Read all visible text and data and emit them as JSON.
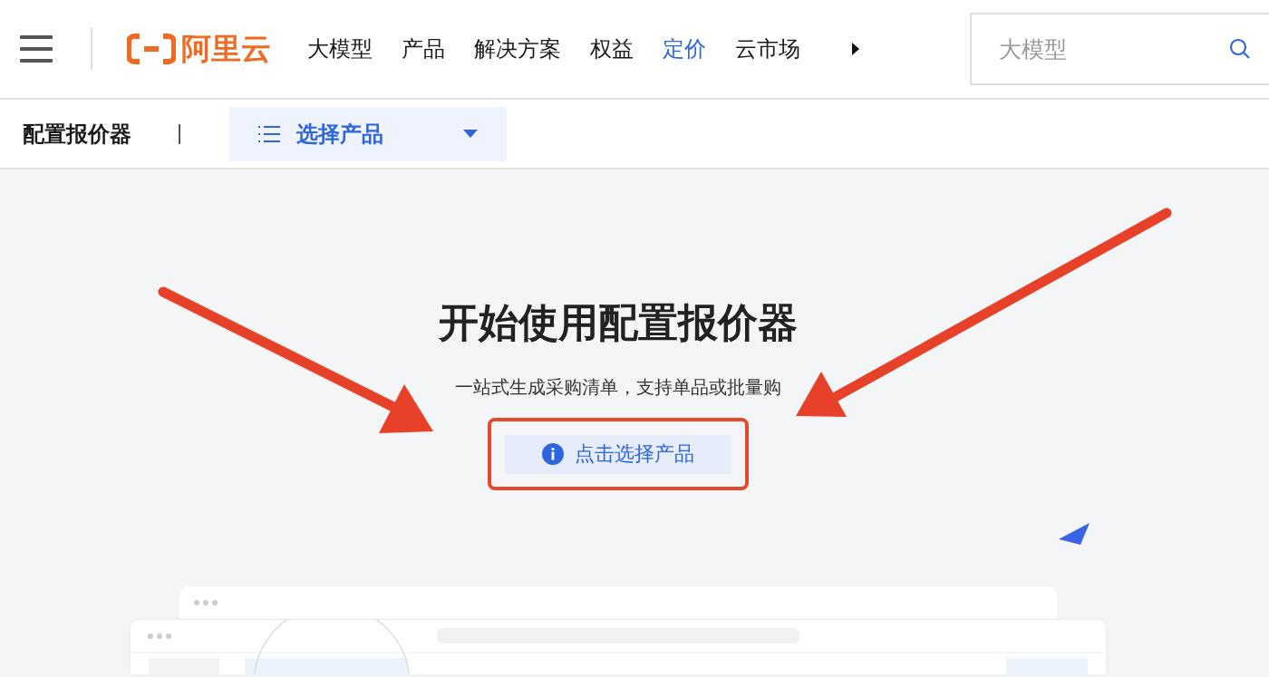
{
  "header": {
    "logo_text": "阿里云",
    "nav": [
      {
        "label": "大模型",
        "selected": false
      },
      {
        "label": "产品",
        "selected": false
      },
      {
        "label": "解决方案",
        "selected": false
      },
      {
        "label": "权益",
        "selected": false
      },
      {
        "label": "定价",
        "selected": true
      },
      {
        "label": "云市场",
        "selected": false
      }
    ],
    "search": {
      "placeholder": "大模型"
    }
  },
  "subbar": {
    "title": "配置报价器",
    "dropdown": "选择产品"
  },
  "main": {
    "heading": "开始使用配置报价器",
    "subtitle": "一站式生成采购清单，支持单品或批量购",
    "button": "点击选择产品"
  }
}
